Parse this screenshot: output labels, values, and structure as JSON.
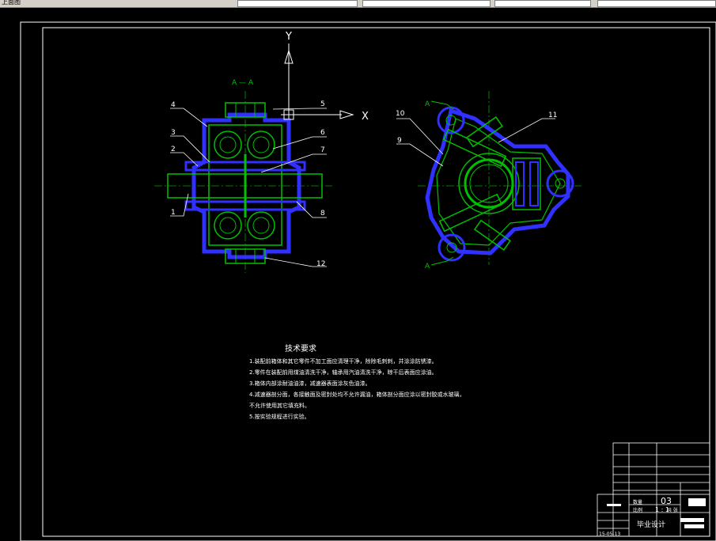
{
  "toolbar": {
    "left_text": "上面图",
    "fields": [
      "",
      "",
      "",
      ""
    ]
  },
  "drawing": {
    "section_label": "A — A",
    "axis_y": "Y",
    "axis_x": "X",
    "section_marks": [
      "A",
      "A"
    ],
    "part_numbers": [
      "1",
      "2",
      "3",
      "4",
      "5",
      "6",
      "7",
      "8",
      "9",
      "10",
      "11",
      "12"
    ]
  },
  "notes": {
    "title": "技术要求",
    "lines": [
      "1.装配前箱体和其它零件不加工面应清理干净，除除毛刺刺，并涂涂防锈漆。",
      "2.零件在装配前用煤油清洗干净，轴承用汽油清洗干净，晾干后表面应涂油。",
      "3.箱体内部涂耐油油漆，减速器表面涂灰色油漆。",
      "4.减速器剖分面，各接触面及密封处均不允许漏油，箱体剖分面应涂以密封胶或水玻璃，",
      "   不允许使用其它填充料。",
      "5.按实验规程进行实验。"
    ]
  },
  "title_block": {
    "sheet_no": "03",
    "scale": "1 : 1",
    "label_scale": "比例",
    "label_qty": "数量",
    "label_sheet": "共 张",
    "project": "毕业设计",
    "date": "15-05-13"
  },
  "colors": {
    "frame": "#ffffff",
    "part": "#00c000",
    "hatch": "#3030ff",
    "centerline": "#00a000"
  }
}
